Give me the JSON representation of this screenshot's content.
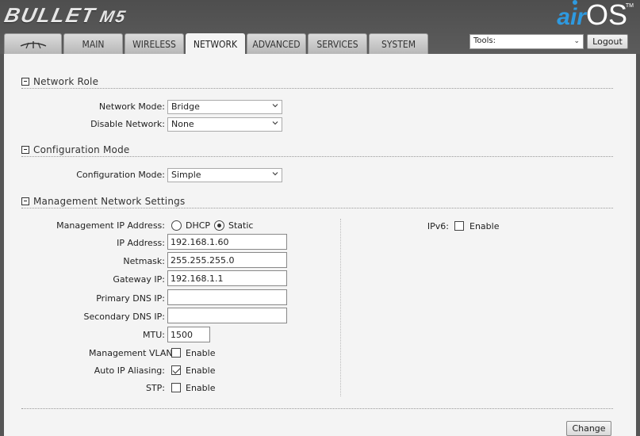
{
  "header": {
    "device_brand": "BULLET",
    "device_model": "M5",
    "logo_air": "air",
    "logo_os": "OS",
    "logo_tm": "TM"
  },
  "tabs": [
    {
      "label": "",
      "icon": "ubiquiti-logo-icon"
    },
    {
      "label": "MAIN"
    },
    {
      "label": "WIRELESS"
    },
    {
      "label": "NETWORK",
      "active": true
    },
    {
      "label": "ADVANCED"
    },
    {
      "label": "SERVICES"
    },
    {
      "label": "SYSTEM"
    }
  ],
  "tools": {
    "selected": "Tools:",
    "logout_label": "Logout"
  },
  "network_role": {
    "title": "Network Role",
    "network_mode_label": "Network Mode:",
    "network_mode_value": "Bridge",
    "disable_network_label": "Disable Network:",
    "disable_network_value": "None"
  },
  "configuration_mode": {
    "title": "Configuration Mode",
    "label": "Configuration Mode:",
    "value": "Simple"
  },
  "management": {
    "title": "Management Network Settings",
    "ip_mode_label": "Management IP Address:",
    "dhcp_label": "DHCP",
    "static_label": "Static",
    "ip_label": "IP Address:",
    "ip_value": "192.168.1.60",
    "netmask_label": "Netmask:",
    "netmask_value": "255.255.255.0",
    "gateway_label": "Gateway IP:",
    "gateway_value": "192.168.1.1",
    "primary_dns_label": "Primary DNS IP:",
    "primary_dns_value": "",
    "secondary_dns_label": "Secondary DNS IP:",
    "secondary_dns_value": "",
    "mtu_label": "MTU:",
    "mtu_value": "1500",
    "vlan_label": "Management VLAN:",
    "alias_label": "Auto IP Aliasing:",
    "stp_label": "STP:",
    "enable_label": "Enable",
    "ipv6_label": "IPv6:"
  },
  "change_label": "Change",
  "colors": {
    "accent_blue": "#2e9ae0",
    "header_bg": "#555555",
    "panel_bg": "#f4f4f4"
  }
}
